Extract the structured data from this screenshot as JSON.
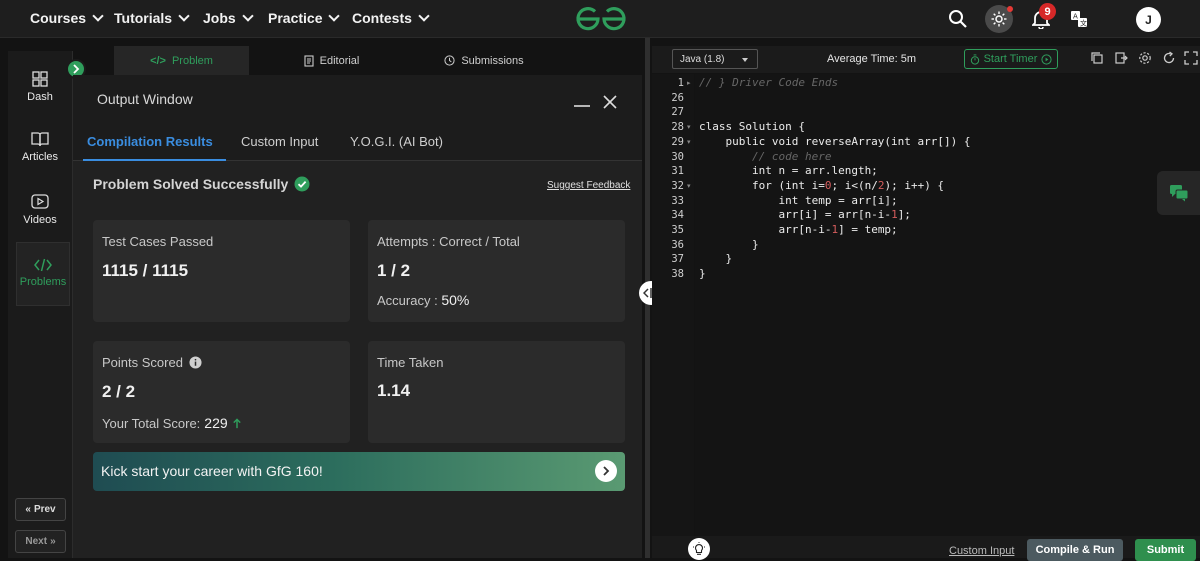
{
  "nav": {
    "items": [
      {
        "label": "Courses"
      },
      {
        "label": "Tutorials"
      },
      {
        "label": "Jobs"
      },
      {
        "label": "Practice"
      },
      {
        "label": "Contests"
      }
    ],
    "notification_count": "9",
    "avatar_initial": "J",
    "brand_color": "#2f9e5c"
  },
  "sidebar": {
    "items": [
      {
        "label": "Dash",
        "icon": "dashboard-icon"
      },
      {
        "label": "Articles",
        "icon": "book-icon"
      },
      {
        "label": "Videos",
        "icon": "video-icon"
      },
      {
        "label": "Problems",
        "icon": "code-icon"
      }
    ],
    "prev_label": "Prev",
    "next_label": "Next"
  },
  "problem_tabs": [
    {
      "label": "Problem"
    },
    {
      "label": "Editorial"
    },
    {
      "label": "Submissions"
    }
  ],
  "output": {
    "title": "Output Window",
    "tabs": [
      {
        "label": "Compilation Results"
      },
      {
        "label": "Custom Input"
      },
      {
        "label": "Y.O.G.I. (AI Bot)"
      }
    ],
    "status": "Problem Solved Successfully",
    "feedback_link": "Suggest Feedback",
    "cards": {
      "tests": {
        "label": "Test Cases Passed",
        "value": "1115 / 1115"
      },
      "attempts": {
        "label": "Attempts : Correct / Total",
        "value": "1 / 2",
        "sub_label": "Accuracy :",
        "sub_value": "50%"
      },
      "points": {
        "label": "Points Scored",
        "value": "2 / 2",
        "sub_label": "Your Total Score:",
        "sub_value": "229"
      },
      "time": {
        "label": "Time Taken",
        "value": "1.14"
      }
    },
    "banner": "Kick start your career with GfG 160!"
  },
  "editor": {
    "language": "Java (1.8)",
    "average_time": "Average Time: 5m",
    "timer_label": "Start Timer",
    "lines": [
      {
        "n": "1",
        "text": "// } Driver Code Ends"
      },
      {
        "n": "26",
        "text": ""
      },
      {
        "n": "27",
        "text": ""
      },
      {
        "n": "28",
        "text": "class Solution {"
      },
      {
        "n": "29",
        "text": "    public void reverseArray(int arr[]) {"
      },
      {
        "n": "30",
        "text": "        // code here"
      },
      {
        "n": "31",
        "text": "        int n = arr.length;"
      },
      {
        "n": "32",
        "text": "        for (int i=0; i<(n/2); i++) {"
      },
      {
        "n": "33",
        "text": "            int temp = arr[i];"
      },
      {
        "n": "34",
        "text": "            arr[i] = arr[n-i-1];"
      },
      {
        "n": "35",
        "text": "            arr[n-i-1] = temp;"
      },
      {
        "n": "36",
        "text": "        }"
      },
      {
        "n": "37",
        "text": "    }"
      },
      {
        "n": "38",
        "text": "}"
      }
    ],
    "custom_input_link": "Custom Input",
    "compile_label": "Compile & Run",
    "submit_label": "Submit"
  }
}
